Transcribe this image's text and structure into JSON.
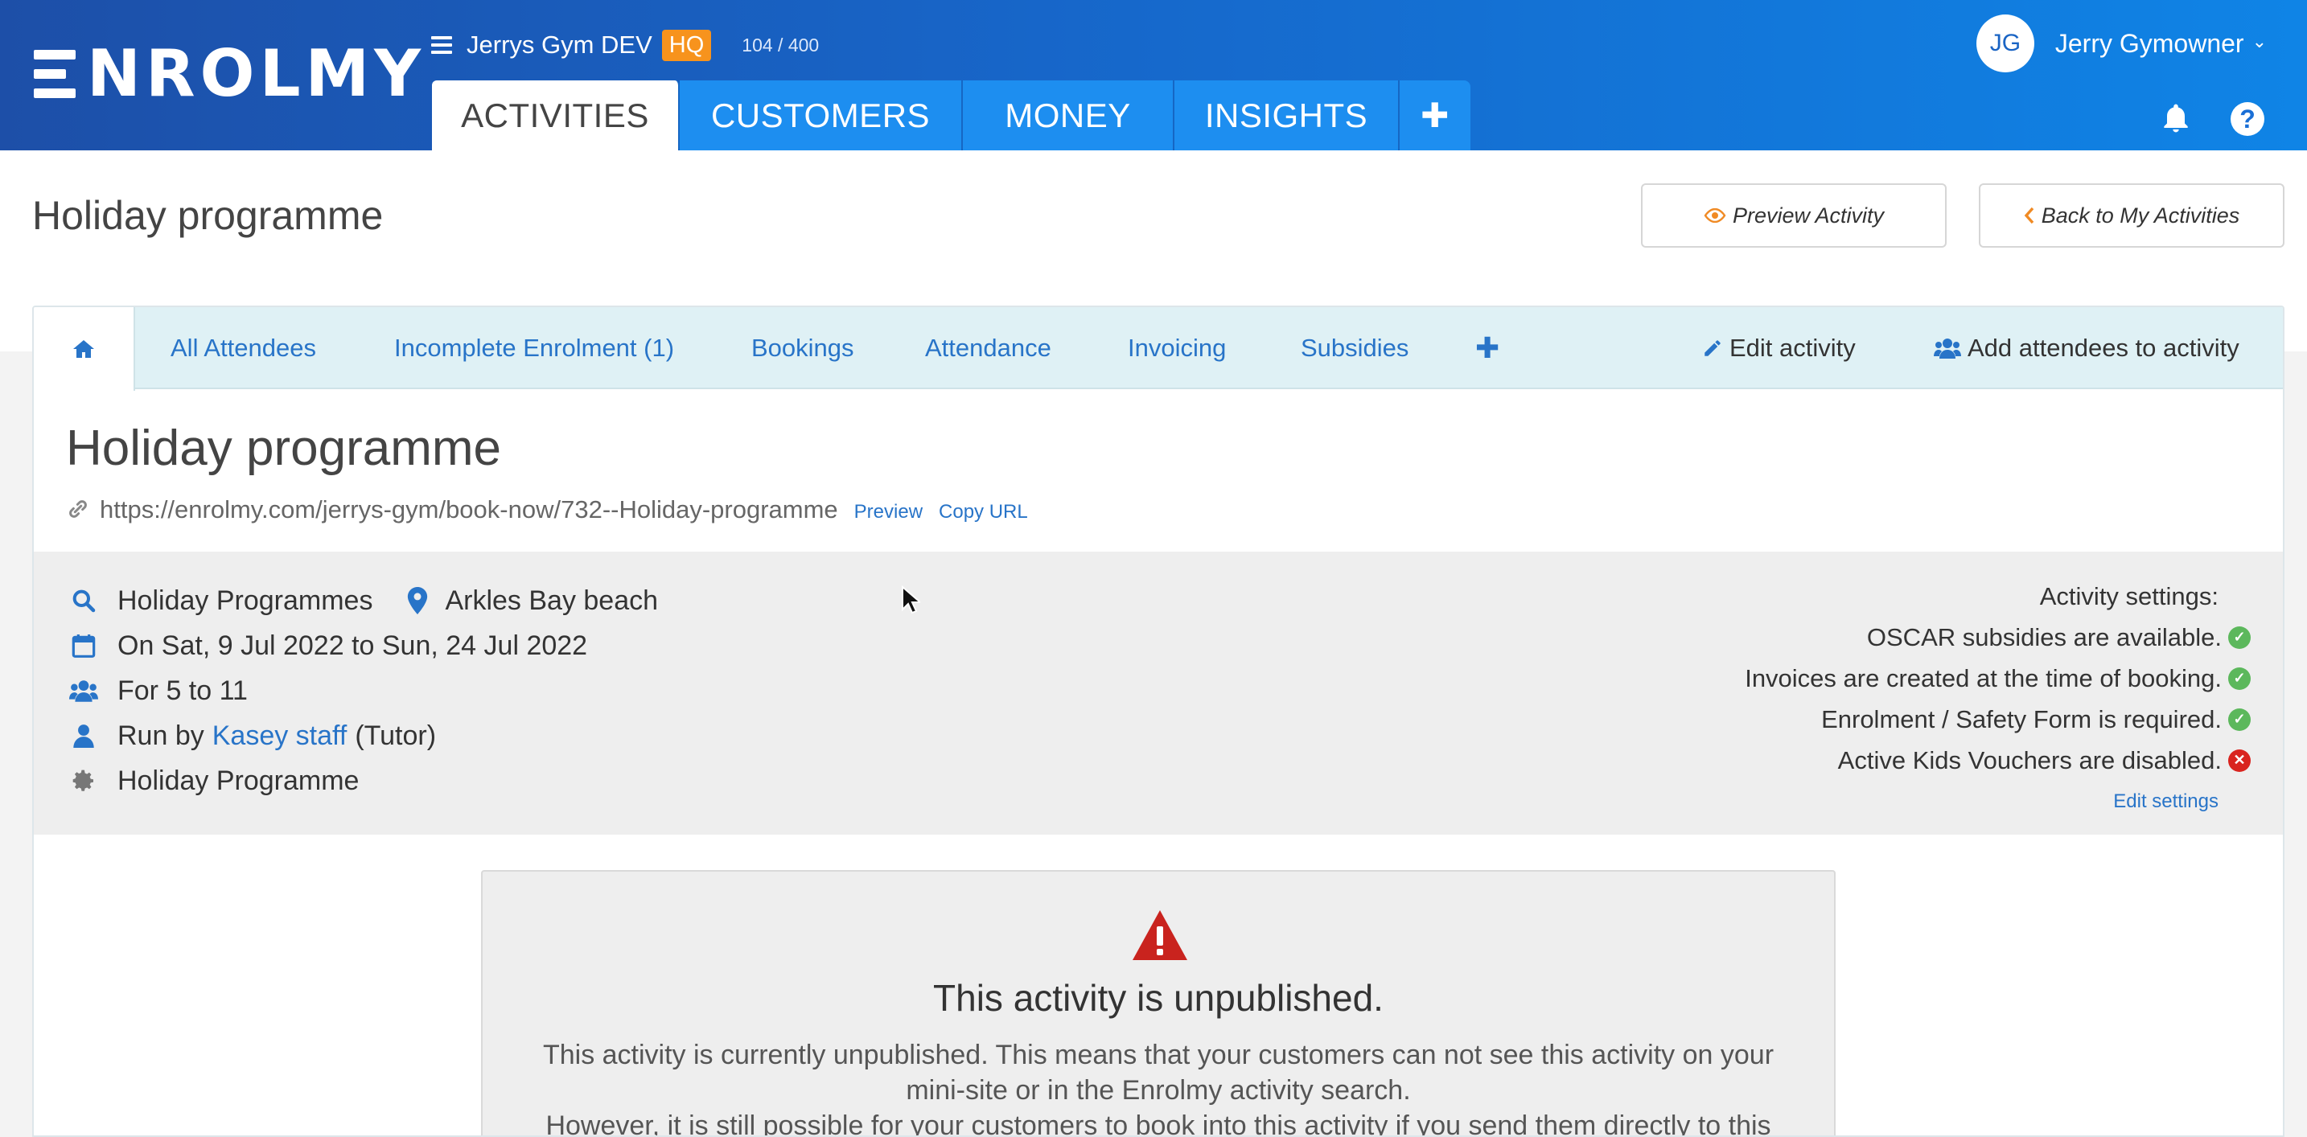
{
  "header": {
    "logo_rest": "NROLMY",
    "org_name": "Jerrys Gym DEV",
    "org_badge": "HQ",
    "org_count": "104 / 400",
    "tabs": [
      {
        "label": "ACTIVITIES",
        "active": true
      },
      {
        "label": "CUSTOMERS"
      },
      {
        "label": "MONEY"
      },
      {
        "label": "INSIGHTS"
      },
      {
        "label": "✚"
      }
    ],
    "user_initials": "JG",
    "user_name": "Jerry Gymowner",
    "caret": "⌄",
    "help": "?"
  },
  "page": {
    "title": "Holiday programme",
    "preview_button": "Preview Activity",
    "back_button": "Back to My Activities"
  },
  "subtabs": {
    "items": [
      "All Attendees",
      "Incomplete Enrolment (1)",
      "Bookings",
      "Attendance",
      "Invoicing",
      "Subsidies",
      "✚"
    ],
    "edit_activity": "Edit activity",
    "add_attendees": "Add attendees to activity"
  },
  "activity": {
    "title": "Holiday programme",
    "url": "https://enrolmy.com/jerrys-gym/book-now/732--Holiday-programme",
    "preview_link": "Preview",
    "copy_link": "Copy URL",
    "category": "Holiday Programmes",
    "location": "Arkles Bay beach",
    "dates": "On Sat, 9 Jul 2022 to Sun, 24 Jul 2022",
    "ages": "For 5 to 11",
    "run_by_prefix": "Run by",
    "run_by_name": "Kasey staff",
    "run_by_role": "(Tutor)",
    "programme_type": "Holiday Programme"
  },
  "settings": {
    "heading": "Activity settings:",
    "items": [
      {
        "text": "OSCAR subsidies are available.",
        "status": "ok"
      },
      {
        "text": "Invoices are created at the time of booking.",
        "status": "ok"
      },
      {
        "text": "Enrolment / Safety Form is required.",
        "status": "ok"
      },
      {
        "text": "Active Kids Vouchers are disabled.",
        "status": "bad"
      }
    ],
    "edit_link": "Edit settings",
    "ok_glyph": "✓",
    "bad_glyph": "✕"
  },
  "alert": {
    "title": "This activity is unpublished.",
    "line1": "This activity is currently unpublished. This means that your customers can not see this activity on your",
    "line2": "mini-site or in the Enrolmy activity search.",
    "line3": "However, it is still possible for your customers to book into this activity if you send them directly to this"
  },
  "colors": {
    "brand_blue": "#1766c9",
    "tab_blue": "#1d8ef0",
    "badge_orange": "#f7931d",
    "link_blue": "#2874c8",
    "success_green": "#5cb85c",
    "danger_red": "#d9241f"
  }
}
